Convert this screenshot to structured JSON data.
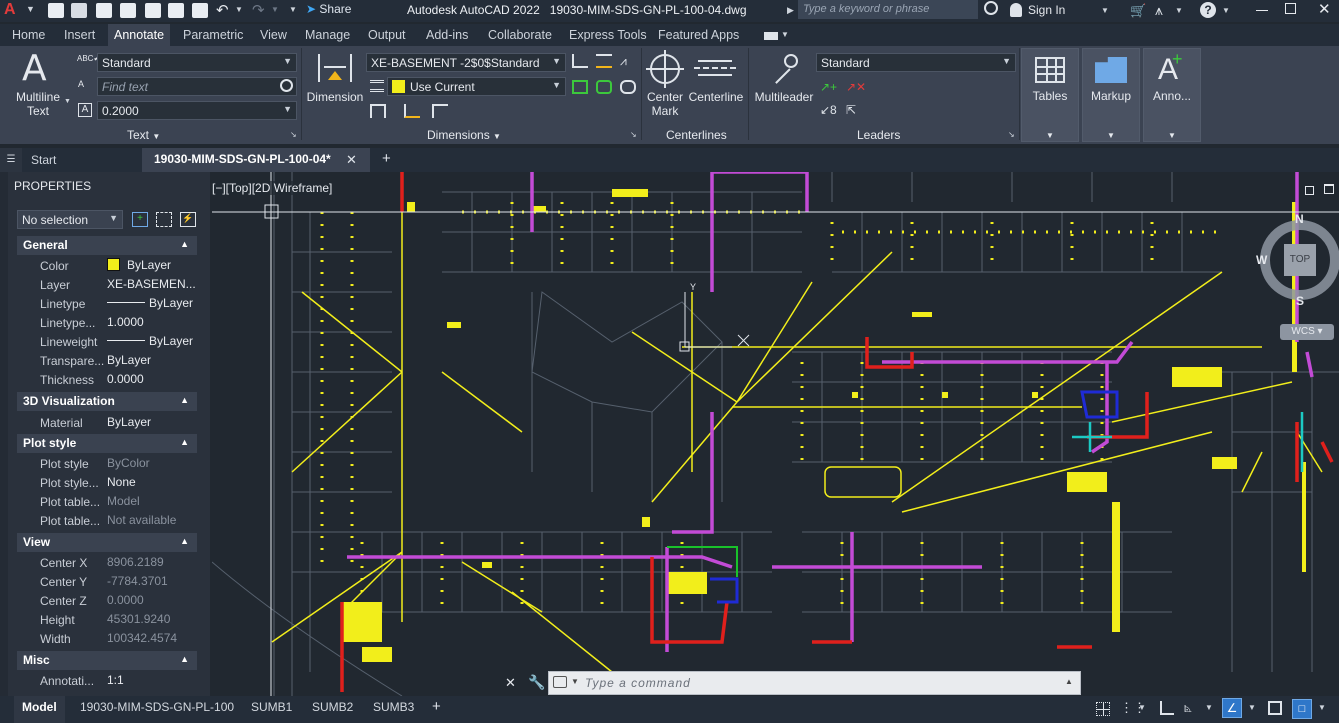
{
  "title_bar": {
    "app_title": "Autodesk AutoCAD 2022",
    "file_name": "19030-MIM-SDS-GN-PL-100-04.dwg",
    "share_label": "Share",
    "search_placeholder": "Type a keyword or phrase",
    "sign_in": "Sign In"
  },
  "ribbon_tabs": [
    "Home",
    "Insert",
    "Annotate",
    "Parametric",
    "View",
    "Manage",
    "Output",
    "Add-ins",
    "Collaborate",
    "Express Tools",
    "Featured Apps"
  ],
  "active_tab": "Annotate",
  "ribbon": {
    "text_panel": {
      "label": "Text",
      "multiline": "Multiline",
      "multiline2": "Text",
      "style": "Standard",
      "find_placeholder": "Find text",
      "height": "0.2000"
    },
    "dimensions_panel": {
      "label": "Dimensions",
      "dimension": "Dimension",
      "dimstyle": "XE-BASEMENT -2$0$Standard",
      "layer": "Use Current"
    },
    "centerlines_panel": {
      "label": "Centerlines",
      "center_mark": "Center",
      "center_mark2": "Mark",
      "centerline": "Centerline"
    },
    "leaders_panel": {
      "label": "Leaders",
      "multileader": "Multileader",
      "style": "Standard"
    },
    "tables": "Tables",
    "markup": "Markup",
    "anno": "Anno..."
  },
  "doc_tabs": {
    "start": "Start",
    "active": "19030-MIM-SDS-GN-PL-100-04*"
  },
  "properties": {
    "title": "PROPERTIES",
    "selection": "No selection",
    "sections": {
      "general": {
        "title": "General",
        "rows": [
          [
            "Color",
            "ByLayer"
          ],
          [
            "Layer",
            "XE-BASEMEN..."
          ],
          [
            "Linetype",
            "ByLayer"
          ],
          [
            "Linetype...",
            "1.0000"
          ],
          [
            "Lineweight",
            "ByLayer"
          ],
          [
            "Transpare...",
            "ByLayer"
          ],
          [
            "Thickness",
            "0.0000"
          ]
        ]
      },
      "viz": {
        "title": "3D Visualization",
        "rows": [
          [
            "Material",
            "ByLayer"
          ]
        ]
      },
      "plot": {
        "title": "Plot style",
        "rows": [
          [
            "Plot style",
            "ByColor"
          ],
          [
            "Plot style...",
            "None"
          ],
          [
            "Plot table...",
            "Model"
          ],
          [
            "Plot table...",
            "Not available"
          ]
        ]
      },
      "view": {
        "title": "View",
        "rows": [
          [
            "Center X",
            "8906.2189"
          ],
          [
            "Center Y",
            "-7784.3701"
          ],
          [
            "Center Z",
            "0.0000"
          ],
          [
            "Height",
            "45301.9240"
          ],
          [
            "Width",
            "100342.4574"
          ]
        ]
      },
      "misc": {
        "title": "Misc",
        "rows": [
          [
            "Annotati...",
            "1:1"
          ]
        ]
      }
    }
  },
  "viewport": {
    "label": "[−][Top][2D Wireframe]",
    "compass": {
      "n": "N",
      "w": "W",
      "s": "S",
      "top": "TOP",
      "wcs": "WCS"
    }
  },
  "command_line": {
    "placeholder": "Type a command"
  },
  "layout_tabs": [
    "Model",
    "19030-MIM-SDS-GN-PL-100",
    "SUMB1",
    "SUMB2",
    "SUMB3"
  ],
  "colors": {
    "drawing_bg": "#212830",
    "yellow": "#f2ee1b",
    "magenta": "#c34bd6",
    "red": "#e0201c",
    "cyan": "#1cc9c3",
    "blue": "#1f2bd6",
    "green": "#19c22b",
    "grey": "#56606d"
  }
}
